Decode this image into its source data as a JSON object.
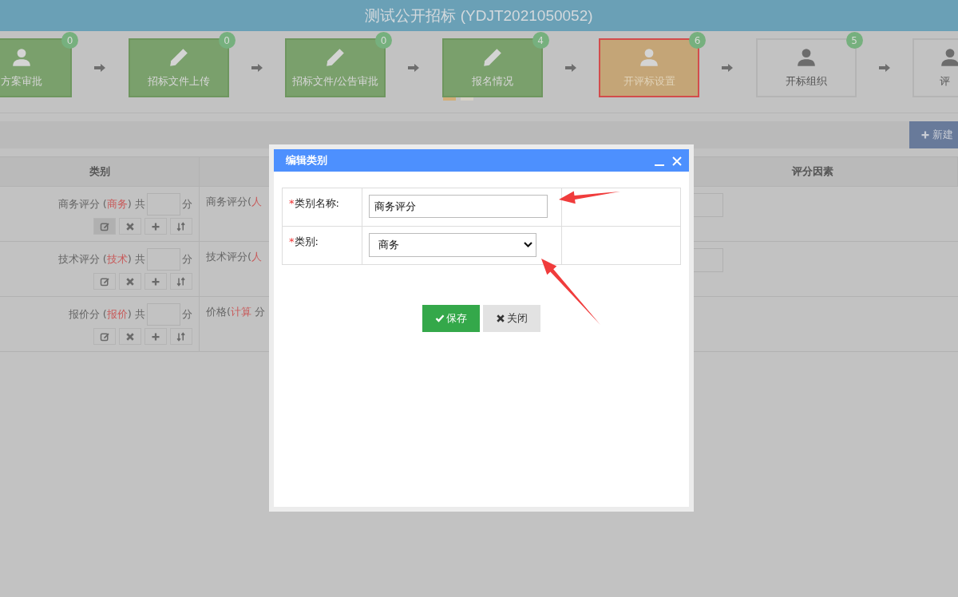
{
  "header": {
    "title": "测试公开招标 (YDJT2021050052)"
  },
  "steps": [
    {
      "label": "方案审批",
      "count": "0",
      "done": true,
      "selected": false,
      "kind": "person"
    },
    {
      "label": "招标文件上传",
      "count": "0",
      "done": true,
      "selected": false,
      "kind": "pencil"
    },
    {
      "label": "招标文件/公告审批",
      "count": "0",
      "done": true,
      "selected": false,
      "kind": "pencil"
    },
    {
      "label": "报名情况",
      "count": "4",
      "done": true,
      "selected": false,
      "kind": "pencil"
    },
    {
      "label": "开评标设置",
      "count": "6",
      "done": true,
      "selected": true,
      "kind": "person"
    },
    {
      "label": "开标组织",
      "count": "5",
      "done": false,
      "selected": false,
      "kind": "person"
    },
    {
      "label": "评",
      "done": false,
      "selected": false,
      "kind": "person"
    }
  ],
  "pager": [
    {
      "selected": true
    },
    {
      "selected": false
    }
  ],
  "toolbar": {
    "new_button": "新建"
  },
  "table": {
    "columns": [
      "类别",
      "",
      "评分因素"
    ],
    "rows": [
      {
        "prefix": "商务评分 (",
        "type": "商务",
        "suffix": ") 共",
        "unit": "分",
        "factor": [
          {
            "kind": "plain",
            "text": "商务评分("
          },
          {
            "kind": "method",
            "text": "人"
          }
        ],
        "score_field": true,
        "actions": [
          {
            "kind": "edit",
            "selected": true
          },
          {
            "kind": "delete",
            "selected": false
          },
          {
            "kind": "add",
            "selected": false
          },
          {
            "kind": "sort",
            "selected": false
          }
        ]
      },
      {
        "prefix": "技术评分 (",
        "type": "技术",
        "suffix": ") 共",
        "unit": "分",
        "factor": [
          {
            "kind": "plain",
            "text": "技术评分("
          },
          {
            "kind": "method",
            "text": "人"
          }
        ],
        "score_field": true,
        "actions": [
          {
            "kind": "edit",
            "selected": false
          },
          {
            "kind": "delete",
            "selected": false
          },
          {
            "kind": "add",
            "selected": false
          },
          {
            "kind": "sort",
            "selected": false
          }
        ]
      },
      {
        "prefix": "报价分 (",
        "type": "报价",
        "suffix": ") 共",
        "unit": "分",
        "factor": [
          {
            "kind": "plain",
            "text": "价格("
          },
          {
            "kind": "method",
            "text": "计算"
          },
          {
            "kind": "plain",
            "text": " 分"
          }
        ],
        "score_field": false,
        "actions": [
          {
            "kind": "edit",
            "selected": false
          },
          {
            "kind": "delete",
            "selected": false
          },
          {
            "kind": "add",
            "selected": false
          },
          {
            "kind": "sort",
            "selected": false
          }
        ]
      }
    ]
  },
  "dialog": {
    "title": "编辑类别",
    "fields": [
      {
        "kind": "text",
        "marker": "*",
        "label": "类别名称:",
        "value": "商务评分"
      },
      {
        "kind": "select",
        "marker": "*",
        "label": "类别:",
        "value": "商务"
      }
    ],
    "buttons": [
      {
        "kind": "save",
        "label": "保存"
      },
      {
        "kind": "close",
        "label": "关闭"
      }
    ]
  }
}
